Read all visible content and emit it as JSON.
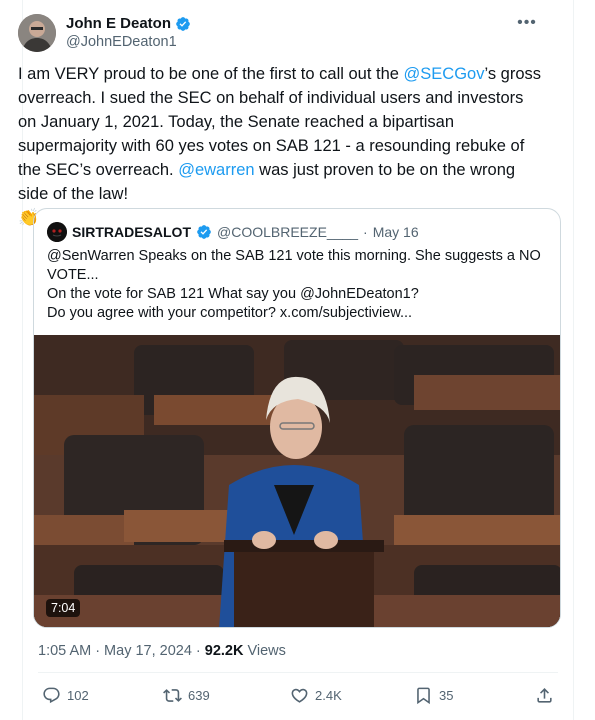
{
  "author": {
    "name": "John E Deaton",
    "handle": "@JohnEDeaton1"
  },
  "tweet": {
    "segments": [
      {
        "text": "I am VERY proud to be one of the first to call out the ",
        "link": false
      },
      {
        "text": "@SECGov",
        "link": true
      },
      {
        "text": "’s gross overreach. I sued the SEC on behalf of individual users and investors on January 1, 2021. Today, the Senate reached a bipartisan supermajority with 60 yes votes on SAB 121 -  a resounding rebuke of the SEC’s overreach. ",
        "link": false
      },
      {
        "text": "@ewarren",
        "link": true
      },
      {
        "text": " was just proven to be on the wrong side of the law!",
        "link": false
      }
    ],
    "emoji": "👏"
  },
  "quote": {
    "name": "SIRTRADESALOT",
    "handle": "@COOLBREEZE____",
    "separator": "·",
    "date": "May 16",
    "lines": [
      "@SenWarren Speaks on the SAB 121 vote this morning. She suggests a NO VOTE...",
      "On the vote for SAB 121 What say you @JohnEDeaton1?",
      "Do you agree with your competitor?  x.com/subjectiview..."
    ],
    "video_duration": "7:04"
  },
  "meta": {
    "time": "1:05 AM",
    "separator": "·",
    "date": "May 17, 2024",
    "separator2": "·",
    "views_count": "92.2K",
    "views_label": "Views"
  },
  "actions": {
    "replies": "102",
    "reposts": "639",
    "likes": "2.4K",
    "bookmarks": "35"
  },
  "colors": {
    "accent": "#1d9bf0",
    "text": "#0f1419",
    "secondary": "#536471",
    "border": "#cfd9de"
  },
  "icons": [
    "more-icon",
    "verified-icon",
    "reply-icon",
    "repost-icon",
    "like-icon",
    "bookmark-icon",
    "share-icon",
    "clap-emoji"
  ]
}
